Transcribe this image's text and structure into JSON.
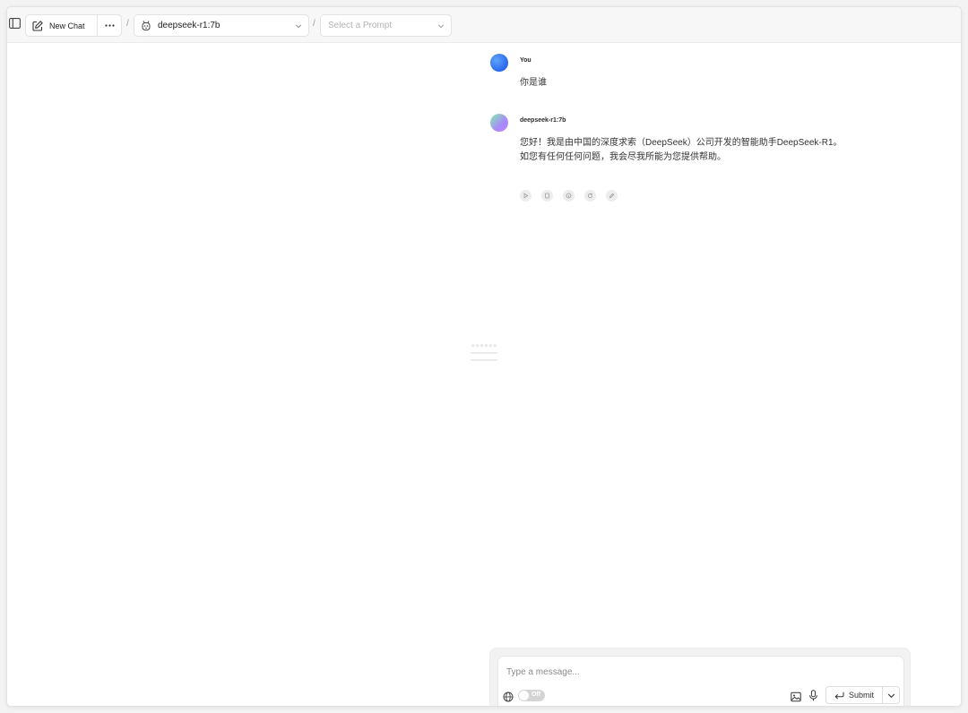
{
  "header": {
    "new_chat_label": "New Chat",
    "separator": "/",
    "model_label": "deepseek-r1:7b",
    "prompt_placeholder": "Select a Prompt"
  },
  "messages": [
    {
      "sender": "You",
      "role": "user",
      "lines": [
        "你是谁"
      ]
    },
    {
      "sender": "deepseek-r1:7b",
      "role": "assistant",
      "lines": [
        "您好！我是由中国的深度求索（DeepSeek）公司开发的智能助手DeepSeek-R1。",
        "如您有任何任何问题，我会尽我所能为您提供帮助。"
      ]
    }
  ],
  "message_actions": [
    "play-icon",
    "copy-icon",
    "info-icon",
    "regenerate-icon",
    "edit-icon"
  ],
  "composer": {
    "placeholder": "Type a message...",
    "web_toggle_label": "Off",
    "submit_label": "Submit"
  },
  "colors": {
    "user_avatar": "#3b82f6",
    "bot_avatar_start": "#86efac",
    "bot_avatar_end": "#c084fc"
  }
}
